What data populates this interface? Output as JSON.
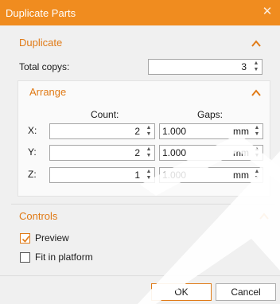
{
  "window": {
    "title": "Duplicate Parts",
    "accent": "#f08c1f"
  },
  "duplicate": {
    "header": "Duplicate",
    "total_copies_label": "Total copys:",
    "total_copies_value": "3"
  },
  "arrange": {
    "header": "Arrange",
    "count_header": "Count:",
    "gaps_header": "Gaps:",
    "rows": [
      {
        "axis": "X:",
        "count": "2",
        "gap": "1.000",
        "unit": "mm"
      },
      {
        "axis": "Y:",
        "count": "2",
        "gap": "1.000",
        "unit": "mm"
      },
      {
        "axis": "Z:",
        "count": "1",
        "gap": "1.000",
        "unit": "mm"
      }
    ]
  },
  "controls": {
    "header": "Controls",
    "preview_label": "Preview",
    "preview_checked": true,
    "fit_label": "Fit in platform",
    "fit_checked": false
  },
  "buttons": {
    "ok": "OK",
    "cancel": "Cancel"
  }
}
